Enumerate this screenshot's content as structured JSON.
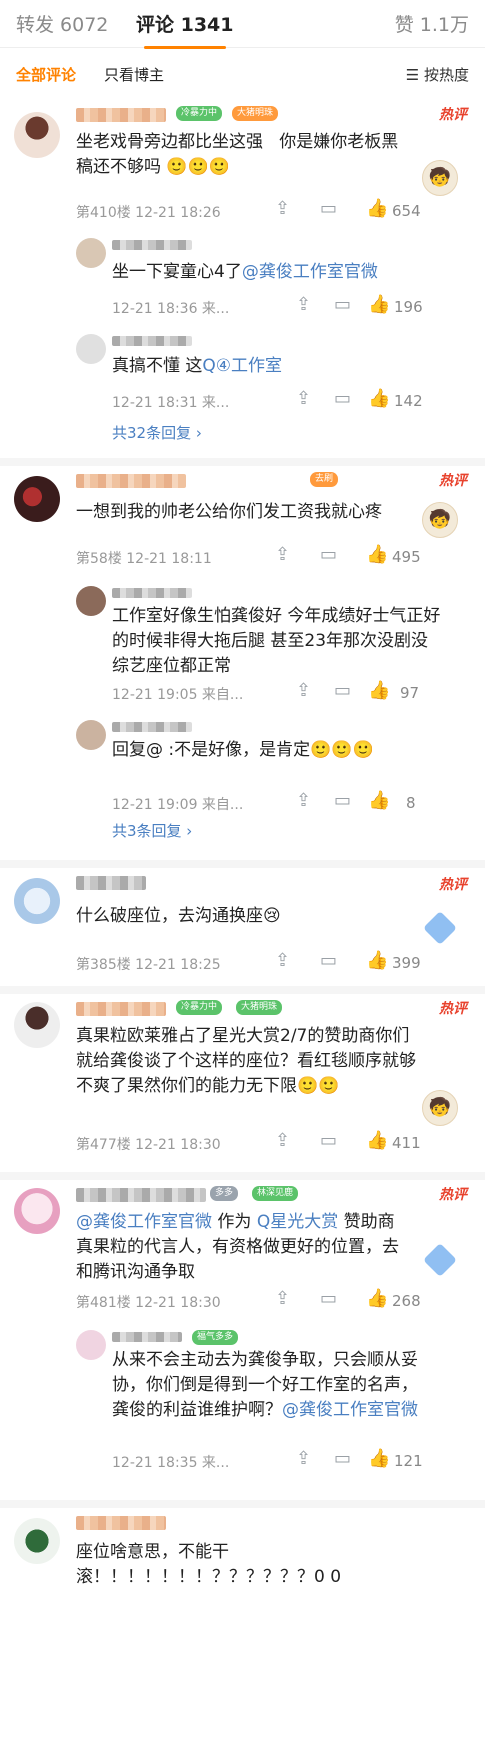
{
  "header": {
    "repost": "转发 6072",
    "comment": "评论 1341",
    "like": "赞 1.1万"
  },
  "filter": {
    "all": "全部评论",
    "owner_only": "只看博主",
    "sort": "按热度"
  },
  "comments": [
    {
      "hot": "热评",
      "badge1": "冷暴力中",
      "badge2": "大猪明珠",
      "text": "坐老戏骨旁边都比坐这强   你是嫌你老板黑稿还不够吗 🙂🙂🙂",
      "meta": "第410楼  12-21 18:26",
      "likes": "654",
      "replies": [
        {
          "text_prefix": "坐一下宴童心4了",
          "mention": "@龚俊工作室官微",
          "meta": "12-21 18:36  来...",
          "likes": "196"
        },
        {
          "text_prefix": "真搞不懂 这",
          "mention": "Q④工作室",
          "meta": "12-21 18:31  来...",
          "likes": "142"
        }
      ],
      "more": "共32条回复 ›"
    },
    {
      "hot": "热评",
      "badge1": "去刷",
      "text": "一想到我的帅老公给你们发工资我就心疼",
      "meta": "第58楼  12-21 18:11",
      "likes": "495",
      "replies": [
        {
          "text": "工作室好像生怕龚俊好 今年成绩好士气正好的时候非得大拖后腿 甚至23年那次没剧没综艺座位都正常",
          "meta": "12-21 19:05  来自...",
          "likes": "97"
        },
        {
          "text": "回复@ :不是好像，是肯定🙂🙂🙂",
          "meta": "12-21 19:09  来自...",
          "likes": "8"
        }
      ],
      "more": "共3条回复 ›"
    },
    {
      "hot": "热评",
      "text": "什么破座位，去沟通换座😢",
      "meta": "第385楼  12-21 18:25",
      "likes": "399"
    },
    {
      "hot": "热评",
      "badge1": "冷暴力中",
      "badge2": "大猪明珠",
      "text": "真果粒欧莱雅占了星光大赏2/7的赞助商你们就给龚俊谈了个这样的座位？看红毯顺序就够不爽了果然你们的能力无下限🙂🙂",
      "meta": "第477楼  12-21 18:30",
      "likes": "411"
    },
    {
      "hot": "热评",
      "badge1": "多多",
      "badge2": "林深见鹿",
      "mention": "@龚俊工作室官微",
      "text_mid": " 作为 ",
      "mention2": "Q星光大赏",
      "text_tail": " 赞助商真果粒的代言人，有资格做更好的位置，去和腾讯沟通争取",
      "meta": "第481楼  12-21 18:30",
      "likes": "268",
      "replies": [
        {
          "badge": "福气多多",
          "text": "从来不会主动去为龚俊争取，只会顺从妥协，你们倒是得到一个好工作室的名声，龚俊的利益谁维护啊？",
          "mention": "@龚俊工作室官微",
          "meta": "12-21 18:35  来...",
          "likes": "121"
        }
      ]
    },
    {
      "text": "座位啥意思，不能干滚！！！！！！！？？？？？？0 0"
    }
  ]
}
